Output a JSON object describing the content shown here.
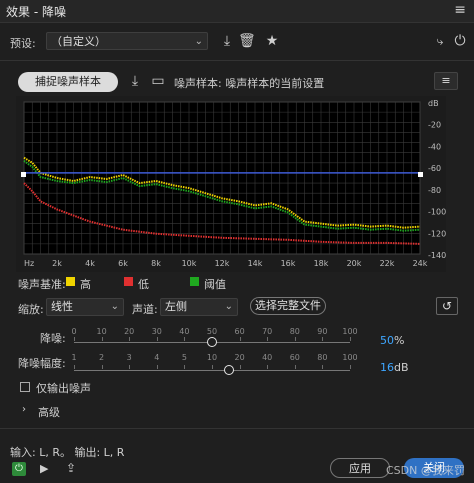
{
  "window": {
    "title": "效果 - 降噪",
    "menu_icon": "hamburger-icon"
  },
  "preset": {
    "label": "预设:",
    "value": "（自定义）"
  },
  "toolbar_icons": [
    "download-icon",
    "trash-icon",
    "star-icon",
    "route-icon",
    "power-icon"
  ],
  "noise": {
    "capture_label": "捕捉噪声样本",
    "status": "噪声样本: 噪声样本的当前设置"
  },
  "graph": {
    "db_labels": [
      "dB",
      "-20",
      "-40",
      "-60",
      "-80",
      "-100",
      "-120",
      "-140"
    ],
    "hz_labels": [
      "Hz",
      "2k",
      "4k",
      "6k",
      "8k",
      "10k",
      "12k",
      "14k",
      "16k",
      "18k",
      "20k",
      "22k",
      "24k"
    ]
  },
  "chart_data": {
    "type": "line",
    "xlabel": "Hz",
    "ylabel": "dB",
    "xlim": [
      0,
      24000
    ],
    "ylim": [
      -150,
      0
    ],
    "series": [
      {
        "name": "高",
        "color": "#f0d400",
        "x": [
          0,
          500,
          1000,
          2000,
          3000,
          4000,
          5000,
          6000,
          7000,
          8000,
          9000,
          10000,
          11000,
          12000,
          13000,
          14000,
          15000,
          16000,
          17000,
          18000,
          19000,
          20000,
          21000,
          22000,
          23000,
          24000
        ],
        "y": [
          -55,
          -60,
          -70,
          -75,
          -78,
          -74,
          -76,
          -72,
          -80,
          -78,
          -82,
          -85,
          -90,
          -95,
          -98,
          -102,
          -100,
          -106,
          -118,
          -120,
          -122,
          -121,
          -123,
          -122,
          -124,
          -123
        ]
      },
      {
        "name": "低",
        "color": "#e03030",
        "x": [
          0,
          500,
          1000,
          2000,
          3000,
          4000,
          5000,
          6000,
          8000,
          10000,
          12000,
          14000,
          16000,
          18000,
          20000,
          22000,
          24000
        ],
        "y": [
          -80,
          -88,
          -98,
          -106,
          -112,
          -118,
          -122,
          -126,
          -130,
          -132,
          -134,
          -135,
          -136,
          -138,
          -139,
          -139,
          -140
        ]
      },
      {
        "name": "阈值",
        "color": "#1fa81f",
        "x": [
          0,
          500,
          1000,
          2000,
          3000,
          4000,
          5000,
          6000,
          7000,
          8000,
          9000,
          10000,
          11000,
          12000,
          13000,
          14000,
          15000,
          16000,
          17000,
          18000,
          19000,
          20000,
          21000,
          22000,
          23000,
          24000
        ],
        "y": [
          -58,
          -64,
          -74,
          -78,
          -80,
          -77,
          -79,
          -75,
          -83,
          -81,
          -85,
          -88,
          -93,
          -98,
          -101,
          -105,
          -103,
          -109,
          -121,
          -123,
          -125,
          -124,
          -126,
          -125,
          -127,
          -126
        ]
      },
      {
        "name": "",
        "color": "#3f5bd6",
        "x": [
          0,
          24000
        ],
        "y": [
          -70,
          -70
        ]
      }
    ]
  },
  "legend": {
    "prefix": "噪声基准:",
    "items": [
      {
        "label": "高",
        "color": "#f0d400"
      },
      {
        "label": "低",
        "color": "#e03030"
      },
      {
        "label": "阈值",
        "color": "#1fa81f"
      }
    ]
  },
  "scale": {
    "label": "缩放:",
    "value": "线性"
  },
  "channel": {
    "label": "声道:",
    "value": "左侧"
  },
  "select_file_label": "选择完整文件",
  "reduction": {
    "label": "降噪:",
    "value": "50",
    "unit": "%",
    "ticks": [
      "0",
      "10",
      "20",
      "30",
      "40",
      "50",
      "60",
      "70",
      "80",
      "90",
      "100"
    ],
    "level": 50
  },
  "reduce_by": {
    "label": "降噪幅度:",
    "value": "16",
    "unit": "dB",
    "ticks": [
      "1",
      "2",
      "3",
      "4",
      "5",
      "10",
      "20",
      "40",
      "60",
      "80",
      "100"
    ],
    "level": 16
  },
  "output_noise_only": {
    "label": "仅输出噪声",
    "checked": false
  },
  "advanced": {
    "label": "高级"
  },
  "io_text": "输入: L, R。 输出: L, R",
  "footer": {
    "apply_label": "应用",
    "close_label": "关闭",
    "watermark": "CSDN @我来罚"
  }
}
